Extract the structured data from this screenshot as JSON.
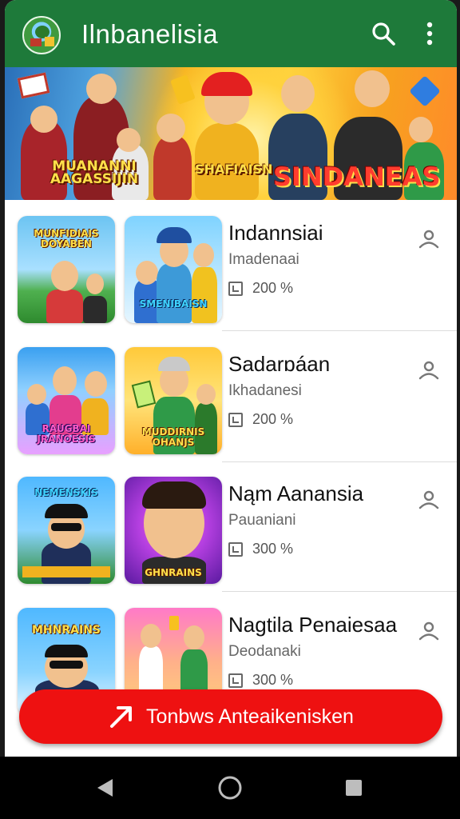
{
  "app_bar": {
    "title": "Ilnbanelisia",
    "logo_icon": "landscape-logo-icon",
    "search_icon": "search-icon",
    "more_icon": "more-vert-icon",
    "background": "#1e7a3a"
  },
  "banner": {
    "texts": [
      "MUANANNI AAGASSIJIN",
      "SHAFIAISN",
      "SINDANEAS"
    ]
  },
  "list": {
    "items": [
      {
        "title": "Indannsiai",
        "subtitle": "Imadenaai",
        "stat": "200 %",
        "thumb_a_text": "MUNFIDIAIS DOYABEN",
        "thumb_b_text": "SMENIBAISN"
      },
      {
        "title": "Sadarɒáan",
        "subtitle": "Ikhadanesi",
        "stat": "200 %",
        "thumb_a_text": "RAUGBAI JRANOESIS",
        "thumb_b_text": "MUDDIRNIS OHANJS"
      },
      {
        "title": "Nąm Aanansia",
        "subtitle": "Pauaniani",
        "stat": "300 %",
        "thumb_a_text": "NEMENSKIS",
        "thumb_b_text": "GHNRAINS"
      },
      {
        "title": "Nagtila Penaiesaa",
        "subtitle": "Deodanaki",
        "stat": "300 %",
        "thumb_a_text": "MHNRAINS",
        "thumb_b_text": ""
      }
    ]
  },
  "cta": {
    "label": "Tonbws Anteaikenisken",
    "icon": "arrow-up-right-icon",
    "color": "#ee1111"
  },
  "navbar": {
    "back_icon": "back-triangle-icon",
    "home_icon": "home-circle-icon",
    "recent_icon": "recent-square-icon"
  }
}
